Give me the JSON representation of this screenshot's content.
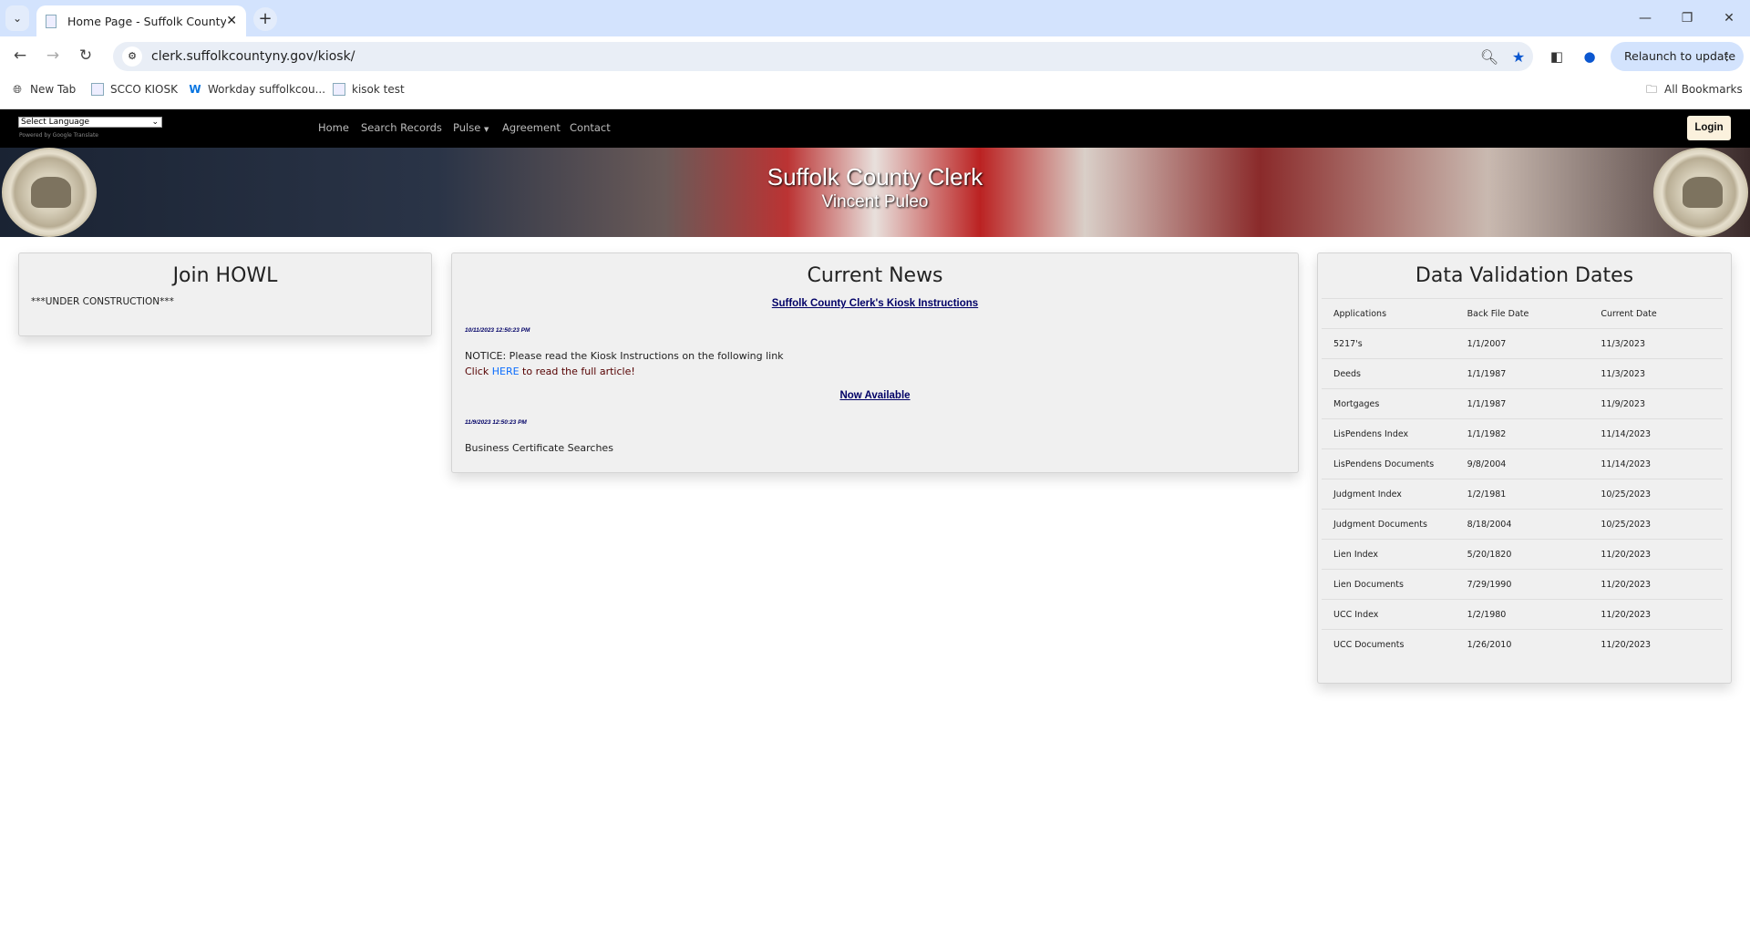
{
  "browser": {
    "tab_title": "Home Page - Suffolk County Clerk",
    "url": "clerk.suffolkcountyny.gov/kiosk/",
    "relaunch_label": "Relaunch to update",
    "bookmarks": [
      {
        "label": "New Tab",
        "icon": "globe-icon"
      },
      {
        "label": "SCCO KIOSK",
        "icon": "page-icon"
      },
      {
        "label": "Workday suffolkcou...",
        "icon": "workday-icon"
      },
      {
        "label": "kisok test",
        "icon": "page-icon"
      }
    ],
    "all_bookmarks_label": "All Bookmarks"
  },
  "site_nav": {
    "language_select": "Select Language",
    "powered_by": "Powered by Google Translate",
    "items": [
      "Home",
      "Search Records",
      "Pulse",
      "Agreement",
      "Contact"
    ],
    "login_label": "Login"
  },
  "banner": {
    "title": "Suffolk County Clerk",
    "subtitle": "Vincent Puleo"
  },
  "howl": {
    "title": "Join HOWL",
    "text": "***UNDER CONSTRUCTION***"
  },
  "news": {
    "title": "Current News",
    "articles": [
      {
        "headline": "Suffolk County Clerk's Kiosk Instructions",
        "date": "10/11/2023 12:50:23 PM",
        "text": "NOTICE: Please read the Kiosk Instructions on the following link",
        "click_pre": "Click ",
        "click_link": "HERE",
        "click_post": " to read the full article!"
      },
      {
        "headline": "Now Available",
        "date": "11/9/2023 12:50:23 PM",
        "text": "Business Certificate Searches"
      }
    ]
  },
  "validation": {
    "title": "Data Validation Dates",
    "headers": [
      "Applications",
      "Back File Date",
      "Current Date"
    ],
    "rows": [
      [
        "5217's",
        "1/1/2007",
        "11/3/2023"
      ],
      [
        "Deeds",
        "1/1/1987",
        "11/3/2023"
      ],
      [
        "Mortgages",
        "1/1/1987",
        "11/9/2023"
      ],
      [
        "LisPendens Index",
        "1/1/1982",
        "11/14/2023"
      ],
      [
        "LisPendens Documents",
        "9/8/2004",
        "11/14/2023"
      ],
      [
        "Judgment Index",
        "1/2/1981",
        "10/25/2023"
      ],
      [
        "Judgment Documents",
        "8/18/2004",
        "10/25/2023"
      ],
      [
        "Lien Index",
        "5/20/1820",
        "11/20/2023"
      ],
      [
        "Lien Documents",
        "7/29/1990",
        "11/20/2023"
      ],
      [
        "UCC Index",
        "1/2/1980",
        "11/20/2023"
      ],
      [
        "UCC Documents",
        "1/26/2010",
        "11/20/2023"
      ]
    ]
  },
  "colors": {
    "nav_bg": "#000000",
    "link_navy": "#000066",
    "here_link": "#0d6efd",
    "click_text": "#550000",
    "login_bg": "#fbf1dd"
  }
}
